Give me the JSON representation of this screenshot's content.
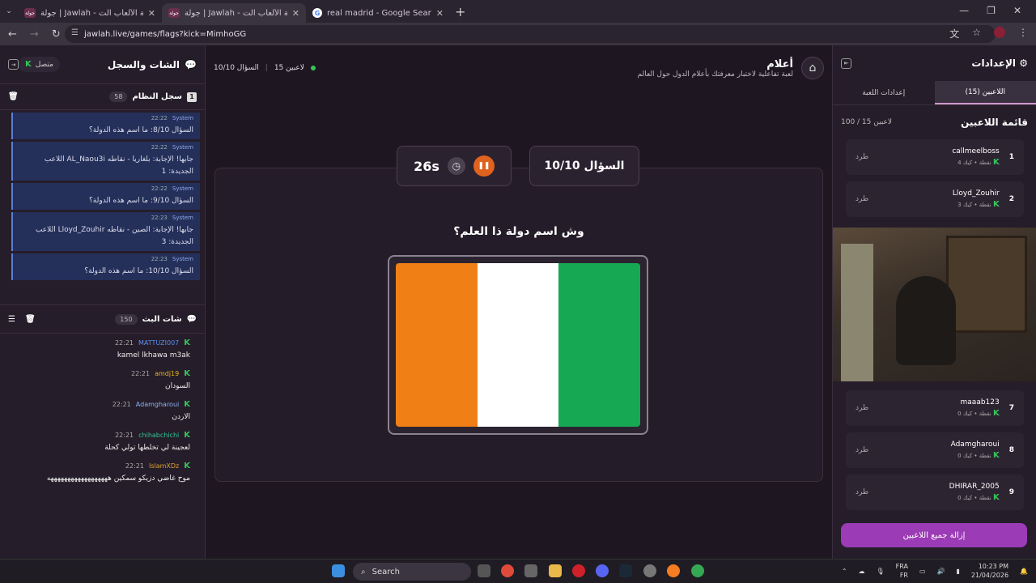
{
  "browser": {
    "tabs": [
      {
        "title": "جولة | Jawlah - منصة الألعاب الت...",
        "fav": "جولة"
      },
      {
        "title": "جولة | Jawlah - منصة الألعاب الت...",
        "fav": "جولة"
      },
      {
        "title": "real madrid - Google Search",
        "fav": "G"
      }
    ],
    "url": "jawlah.live/games/flags?kick=MimhoGG"
  },
  "left": {
    "title": "الشات والسجل",
    "status": "متصل",
    "system": {
      "title": "سجل النظام",
      "count": "58",
      "num": "1"
    },
    "sys_msgs": [
      {
        "sender": "System",
        "time": "22:22",
        "text": "السؤال 8/10: ما اسم هذه الدولة؟"
      },
      {
        "sender": "System",
        "time": "22:22",
        "text": "اللاعب AL_Naou3i جابها! الإجابة: بلغاريا - نقاطه الجديدة: 1"
      },
      {
        "sender": "System",
        "time": "22:22",
        "text": "السؤال 9/10: ما اسم هذه الدولة؟"
      },
      {
        "sender": "System",
        "time": "22:23",
        "text": "اللاعب Lloyd_Zouhir جابها! الإجابة: الصين - نقاطه الجديدة: 3"
      },
      {
        "sender": "System",
        "time": "22:23",
        "text": "السؤال 10/10: ما اسم هذه الدولة؟"
      }
    ],
    "stream": {
      "title": "شات البث",
      "count": "150"
    },
    "chat": [
      {
        "user": "MATTUZI007",
        "color": "#5b8def",
        "time": "22:21",
        "text": "kamel lkhawa m3ak"
      },
      {
        "user": "amdj19",
        "color": "#e6b422",
        "time": "22:21",
        "text": "السودان"
      },
      {
        "user": "Adamgharoui",
        "color": "#8ab4f8",
        "time": "22:21",
        "text": "الاردن"
      },
      {
        "user": "chihabchichi",
        "color": "#35c59a",
        "time": "22:21",
        "text": "لعجينة لي تخلطها تولي كحلة"
      },
      {
        "user": "IslamXDz",
        "color": "#e0a030",
        "time": "22:21",
        "text": "موح غاضي دزيكو سمكين ههههههههههههههههههه"
      }
    ]
  },
  "center": {
    "title": "أعلام",
    "subtitle": "لعبة تفاعلية لاختبار معرفتك بأعلام الدول حول العالم",
    "players": "15 لاعبين",
    "question_short": "السؤال 10/10",
    "question_label": "السؤال 10/10",
    "timer": "26s",
    "question": "وش اسم دولة ذا العلم؟",
    "flag_colors": [
      "#f07f16",
      "#ffffff",
      "#16a853"
    ]
  },
  "right": {
    "title": "الإعدادات",
    "tab_players": "اللاعبين (15)",
    "tab_settings": "إعدادات اللعبة",
    "list_title": "قائمة اللاعبين",
    "list_count": "100 / 15 لاعبين",
    "kick": "طرد",
    "players": [
      {
        "rank": "1",
        "name": "callmeelboss",
        "pts": "4 نقطة",
        "src": "كيك"
      },
      {
        "rank": "2",
        "name": "Lloyd_Zouhir",
        "pts": "3 نقطة",
        "src": "كيك"
      },
      {
        "rank": "7",
        "name": "maaab123",
        "pts": "0 نقطة",
        "src": "كيك"
      },
      {
        "rank": "8",
        "name": "Adamgharoui",
        "pts": "0 نقطة",
        "src": "كيك"
      },
      {
        "rank": "9",
        "name": "DHIRAR_2005",
        "pts": "0 نقطة",
        "src": "كيك"
      }
    ],
    "remove_all": "إزالة جميع اللاعبين"
  },
  "taskbar": {
    "search": "Search",
    "lang1": "FRA",
    "lang2": "FR",
    "time": "10:23 PM",
    "date": "21/04/2026"
  }
}
